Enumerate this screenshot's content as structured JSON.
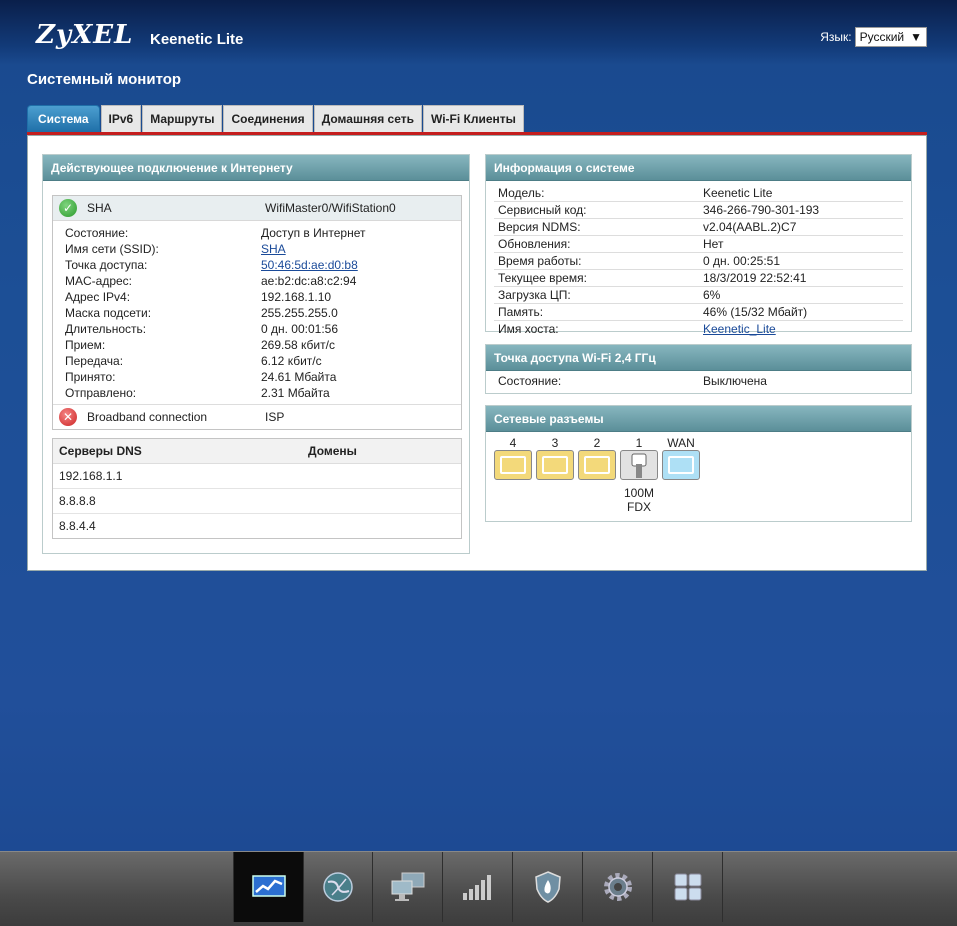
{
  "header": {
    "brand": "ZyXEL",
    "model": "Keenetic Lite",
    "lang_label": "Язык:",
    "lang_value": "Русский"
  },
  "page_title": "Системный монитор",
  "tabs": [
    "Система",
    "IPv6",
    "Маршруты",
    "Соединения",
    "Домашняя сеть",
    "Wi-Fi Клиенты"
  ],
  "internet": {
    "title": "Действующее подключение к Интернету",
    "active": {
      "name": "SHA",
      "iface": "WifiMaster0/WifiStation0"
    },
    "rows": [
      {
        "k": "Состояние:",
        "v": "Доступ в Интернет"
      },
      {
        "k": "Имя сети (SSID):",
        "v": "SHA"
      },
      {
        "k": "Точка доступа:",
        "v": "50:46:5d:ae:d0:b8"
      },
      {
        "k": "MAC-адрес:",
        "v": "ae:b2:dc:a8:c2:94"
      },
      {
        "k": "Адрес IPv4:",
        "v": "192.168.1.10"
      },
      {
        "k": "Маска подсети:",
        "v": "255.255.255.0"
      },
      {
        "k": "Длительность:",
        "v": "0 дн. 00:01:56"
      },
      {
        "k": "Прием:",
        "v": "269.58 кбит/с"
      },
      {
        "k": "Передача:",
        "v": "6.12 кбит/с"
      },
      {
        "k": "Принято:",
        "v": "24.61 Мбайта"
      },
      {
        "k": "Отправлено:",
        "v": "2.31 Мбайта"
      }
    ],
    "other": {
      "name": "Broadband connection",
      "iface": "ISP"
    }
  },
  "dns": {
    "col1": "Серверы DNS",
    "col2": "Домены",
    "rows": [
      "192.168.1.1",
      "8.8.8.8",
      "8.8.4.4"
    ]
  },
  "sysinfo": {
    "title": "Информация о системе",
    "rows": [
      {
        "k": "Модель:",
        "v": "Keenetic Lite"
      },
      {
        "k": "Сервисный код:",
        "v": "346-266-790-301-193"
      },
      {
        "k": "Версия NDMS:",
        "v": "v2.04(AABL.2)C7"
      },
      {
        "k": "Обновления:",
        "v": "Нет"
      },
      {
        "k": "Время работы:",
        "v": "0 дн. 00:25:51"
      },
      {
        "k": "Текущее время:",
        "v": "18/3/2019 22:52:41"
      },
      {
        "k": "Загрузка ЦП:",
        "v": "6%"
      },
      {
        "k": "Память:",
        "v": "46% (15/32 Мбайт)"
      },
      {
        "k": "Имя хоста:",
        "v": "Keenetic_Lite"
      }
    ]
  },
  "wifi": {
    "title": "Точка доступа Wi-Fi 2,4 ГГц",
    "state_k": "Состояние:",
    "state_v": "Выключена"
  },
  "ports": {
    "title": "Сетевые разъемы",
    "items": [
      {
        "n": "4",
        "color": "#f3d97a"
      },
      {
        "n": "3",
        "color": "#f3d97a"
      },
      {
        "n": "2",
        "color": "#f3d97a"
      },
      {
        "n": "1",
        "color": "#e2e2e2"
      },
      {
        "n": "WAN",
        "color": "#aee0f5"
      }
    ],
    "speed": "100M",
    "duplex": "FDX"
  },
  "nav_icons": [
    "monitor-icon",
    "internet-globe-icon",
    "home-network-icon",
    "wifi-signal-icon",
    "security-shield-icon",
    "settings-gear-icon",
    "apps-grid-icon"
  ]
}
